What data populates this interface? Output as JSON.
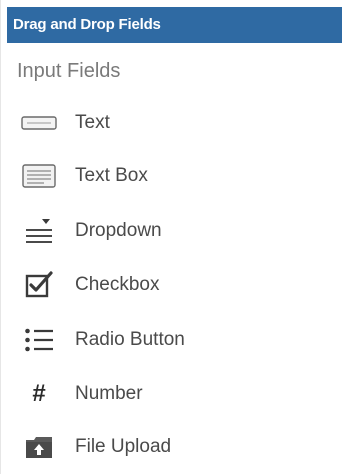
{
  "panel": {
    "header_title": "Drag and Drop Fields",
    "section_title": "Input Fields"
  },
  "fields": [
    {
      "label": "Text",
      "icon": "text-field-icon"
    },
    {
      "label": "Text Box",
      "icon": "text-box-icon"
    },
    {
      "label": "Dropdown",
      "icon": "dropdown-icon"
    },
    {
      "label": "Checkbox",
      "icon": "checkbox-icon"
    },
    {
      "label": "Radio Button",
      "icon": "radio-button-icon"
    },
    {
      "label": "Number",
      "icon": "number-icon",
      "glyph": "#"
    },
    {
      "label": "File Upload",
      "icon": "file-upload-icon"
    }
  ],
  "colors": {
    "header_bg": "#2f6aa3",
    "header_text": "#ffffff",
    "section_text": "#7a7a7a",
    "label_text": "#4a4a4a"
  }
}
